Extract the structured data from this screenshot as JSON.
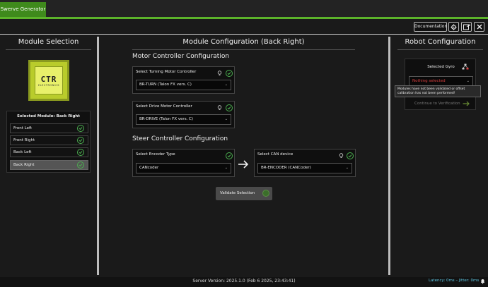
{
  "app": {
    "tab_title": "Swerve Generator"
  },
  "toolbar": {
    "documentation_label": "Documentation",
    "buttons": [
      "gear-icon",
      "export-icon",
      "close-icon"
    ]
  },
  "left_panel": {
    "title": "Module Selection",
    "logo_text": "CTR",
    "logo_subtext": "ELECTRONICS",
    "selected_module_label": "Selected Module: Back Right",
    "modules": [
      {
        "label": "Front Left",
        "status": "valid"
      },
      {
        "label": "Front Right",
        "status": "valid"
      },
      {
        "label": "Back Left",
        "status": "valid"
      },
      {
        "label": "Back Right",
        "status": "valid",
        "selected": true
      }
    ]
  },
  "main": {
    "title": "Module Configuration (Back Right)",
    "motor_section_title": "Motor Controller Configuration",
    "turning": {
      "label": "Select Turning Motor Controller",
      "value": "BR-TURN (Talon FX vers. C)"
    },
    "drive": {
      "label": "Select Drive Motor Controller",
      "value": "BR-DRIVE (Talon FX vers. C)"
    },
    "steer_section_title": "Steer Controller Configuration",
    "encoder_type": {
      "label": "Select Encoder Type",
      "value": "CANcoder"
    },
    "can_device": {
      "label": "Select CAN device",
      "value": "BR-ENCODER (CANCoder)"
    },
    "validate_label": "Validate Selection"
  },
  "right_panel": {
    "title": "Robot Configuration",
    "gyro_title": "Selected Gyro",
    "gyro_value": "Nothing selected",
    "tooltip": "Modules have not been validated or offset calibration has not been performed!",
    "continue_label": "Continue to Verification"
  },
  "footer": {
    "server_version": "Server Version:  2025.1.0 (Feb  6 2025, 23:43:41)",
    "latency": "Latency: 0ms – Jitter: 0ms"
  },
  "colors": {
    "accent_green": "#5cb32a",
    "tab_green": "#3f8a1c",
    "check_green": "#4caf50",
    "warning_red": "#d94040",
    "latency_blue": "#5fc7e3"
  }
}
